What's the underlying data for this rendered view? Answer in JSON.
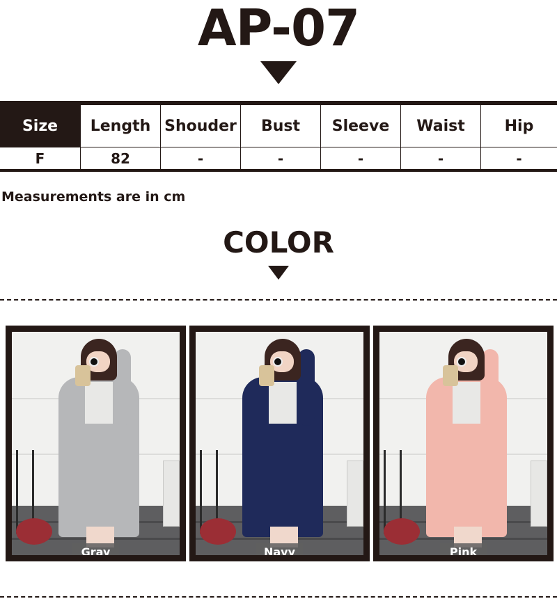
{
  "product": {
    "code": "AP-07"
  },
  "size_table": {
    "headers": [
      "Size",
      "Length",
      "Shouder",
      "Bust",
      "Sleeve",
      "Waist",
      "Hip"
    ],
    "rows": [
      [
        "F",
        "82",
        "-",
        "-",
        "-",
        "-",
        "-"
      ]
    ]
  },
  "note": "Measurements are in cm",
  "color_section": {
    "title": "COLOR"
  },
  "colors": [
    {
      "label": "Gray",
      "swatch": "#b6b7b9"
    },
    {
      "label": "Navy",
      "swatch": "#1f2a5a"
    },
    {
      "label": "Pink",
      "swatch": "#f2b7ac"
    }
  ],
  "theme": {
    "dark": "#231815",
    "label_bg": "#5f5f5f"
  }
}
